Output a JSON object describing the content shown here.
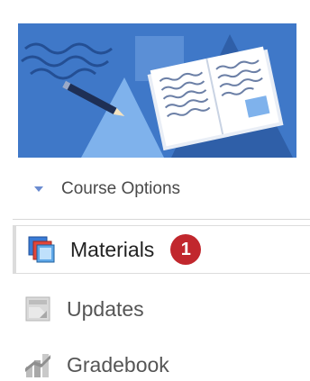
{
  "course_options": {
    "label": "Course Options"
  },
  "nav": {
    "items": [
      {
        "label": "Materials",
        "badge": "1",
        "icon": "materials-icon",
        "active": true
      },
      {
        "label": "Updates",
        "icon": "updates-icon",
        "active": false
      },
      {
        "label": "Gradebook",
        "icon": "gradebook-icon",
        "active": false
      }
    ]
  },
  "colors": {
    "banner_bg": "#3f78c8",
    "badge": "#c1272d",
    "caret": "#6a8bd0"
  }
}
